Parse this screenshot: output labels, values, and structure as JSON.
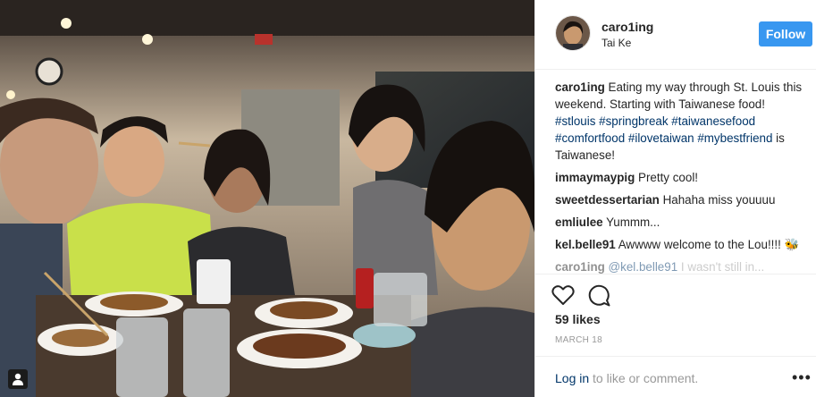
{
  "post": {
    "username": "caro1ing",
    "location": "Tai Ke",
    "follow_label": "Follow",
    "comments": [
      {
        "user": "caro1ing",
        "parts": [
          {
            "t": "text",
            "v": " Eating my way through St. Louis this weekend. Starting with Taiwanese food! "
          },
          {
            "t": "tag",
            "v": "#stlouis"
          },
          {
            "t": "text",
            "v": " "
          },
          {
            "t": "tag",
            "v": "#springbreak"
          },
          {
            "t": "text",
            "v": " "
          },
          {
            "t": "tag",
            "v": "#taiwanesefood"
          },
          {
            "t": "text",
            "v": " "
          },
          {
            "t": "tag",
            "v": "#comfortfood"
          },
          {
            "t": "text",
            "v": " "
          },
          {
            "t": "tag",
            "v": "#ilovetaiwan"
          },
          {
            "t": "text",
            "v": " "
          },
          {
            "t": "tag",
            "v": "#mybestfriend"
          },
          {
            "t": "text",
            "v": " is Taiwanese!"
          }
        ]
      },
      {
        "user": "immaymaypig",
        "parts": [
          {
            "t": "text",
            "v": " Pretty cool!"
          }
        ]
      },
      {
        "user": "sweetdessertarian",
        "parts": [
          {
            "t": "text",
            "v": " Hahaha miss youuuu"
          }
        ]
      },
      {
        "user": "emliulee",
        "parts": [
          {
            "t": "text",
            "v": " Yummm..."
          }
        ]
      },
      {
        "user": "kel.belle91",
        "parts": [
          {
            "t": "text",
            "v": " Awwww welcome to the Lou!!!! 🐝"
          }
        ]
      },
      {
        "user": "caro1ing",
        "parts": [
          {
            "t": "tag",
            "v": " @kel.belle91"
          },
          {
            "t": "text",
            "v": " I wasn't still in..."
          }
        ],
        "faded": true
      }
    ],
    "likes": "59 likes",
    "date": "MARCH 18",
    "footer": {
      "login_link": "Log in",
      "login_rest": " to like or comment.",
      "more": "•••"
    }
  },
  "icons": {
    "like": "heart-icon",
    "comment": "speech-bubble-icon",
    "user_tag": "person-icon",
    "more": "more-options-icon"
  },
  "colors": {
    "follow_bg": "#3897f0",
    "hashtag": "#003569",
    "text": "#262626",
    "muted": "#999999"
  }
}
